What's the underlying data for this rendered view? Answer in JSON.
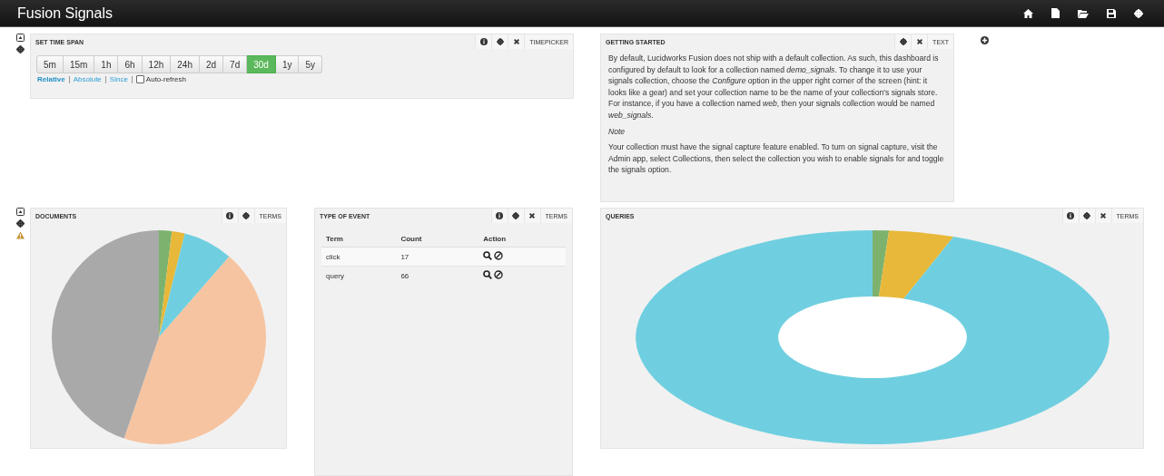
{
  "app_title": "Fusion Signals",
  "timepicker": {
    "title": "SET TIME SPAN",
    "has_info": true,
    "type_label": "TIMEPICKER",
    "spans": [
      {
        "label": "5m",
        "selected": false
      },
      {
        "label": "15m",
        "selected": false
      },
      {
        "label": "1h",
        "selected": false
      },
      {
        "label": "6h",
        "selected": false
      },
      {
        "label": "12h",
        "selected": false
      },
      {
        "label": "24h",
        "selected": false
      },
      {
        "label": "2d",
        "selected": false
      },
      {
        "label": "7d",
        "selected": false
      },
      {
        "label": "30d",
        "selected": true
      },
      {
        "label": "1y",
        "selected": false
      },
      {
        "label": "5y",
        "selected": false
      }
    ],
    "modes": [
      {
        "label": "Relative",
        "selected": true
      },
      {
        "label": "Absolute",
        "selected": false
      },
      {
        "label": "Since",
        "selected": false
      }
    ],
    "auto_refresh": {
      "label": "Auto-refresh",
      "checked": false
    }
  },
  "getting_started": {
    "title": "GETTING STARTED",
    "has_info": false,
    "type_label": "TEXT",
    "paragraphs": [
      {
        "kind": "body",
        "text": "By default, Lucidworks Fusion does not ship with a default collection. As such, this dashboard is configured by default to look for a collection named *demo_signals*. To change it to use your signals collection, choose the *Configure* option in the upper right corner of the screen (hint: it looks like a gear) and set your collection name to be the name of your collection's signals store. For instance, if you have a collection named *web*, then your signals collection would be named *web_signals*."
      },
      {
        "kind": "note",
        "text": "Note"
      },
      {
        "kind": "body",
        "text": "Your collection must have the signal capture feature enabled. To turn on signal capture, visit the Admin app, select Collections, then select the collection you wish to enable signals for and toggle the signals option."
      }
    ]
  },
  "documents": {
    "title": "DOCUMENTS",
    "has_info": true,
    "has_close": false,
    "type_label": "TERMS",
    "warning": true
  },
  "type_of_event": {
    "title": "TYPE OF EVENT",
    "has_info": true,
    "has_close": true,
    "type_label": "TERMS",
    "columns": [
      "Term",
      "Count",
      "Action"
    ],
    "rows": [
      {
        "term": "click",
        "count": "17"
      },
      {
        "term": "query",
        "count": "66"
      }
    ]
  },
  "queries": {
    "title": "QUERIES",
    "has_info": true,
    "has_close": true,
    "type_label": "TERMS"
  }
}
